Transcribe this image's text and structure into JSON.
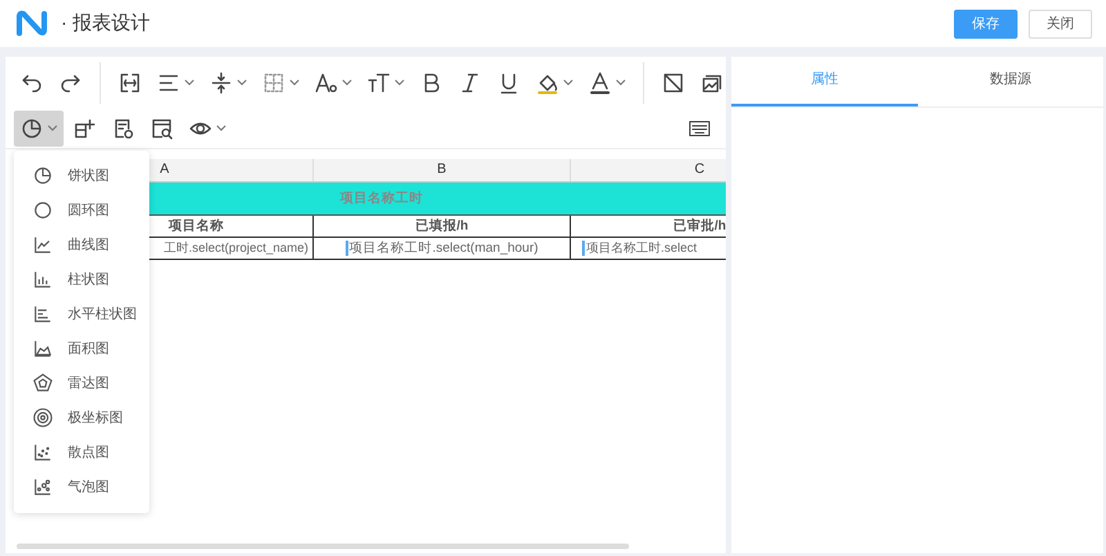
{
  "header": {
    "title": "· 报表设计",
    "buttons": [
      {
        "label": "保存",
        "kind": "primary"
      },
      {
        "label": "关闭",
        "kind": "default"
      }
    ]
  },
  "toolbar": {
    "chart_menu_expanded": true
  },
  "chart_menu": [
    {
      "label": "饼状图",
      "kind": "pie"
    },
    {
      "label": "圆环图",
      "kind": "donut"
    },
    {
      "label": "曲线图",
      "kind": "line"
    },
    {
      "label": "柱状图",
      "kind": "bar"
    },
    {
      "label": "水平柱状图",
      "kind": "hbar"
    },
    {
      "label": "面积图",
      "kind": "area"
    },
    {
      "label": "雷达图",
      "kind": "radar"
    },
    {
      "label": "极坐标图",
      "kind": "polar"
    },
    {
      "label": "散点图",
      "kind": "scatter"
    },
    {
      "label": "气泡图",
      "kind": "bubble"
    }
  ],
  "sheet": {
    "columns": [
      "A",
      "B",
      "C"
    ],
    "title": "项目名称工时",
    "header_row": [
      "项目名称",
      "已填报/h",
      "已审批/h"
    ],
    "data_row": [
      "工时.select(project_name)",
      "项目名称工时.select(man_hour)",
      "项目名称工时.select"
    ]
  },
  "side_tabs": [
    {
      "label": "属性",
      "selected": true
    },
    {
      "label": "数据源",
      "selected": false
    }
  ]
}
